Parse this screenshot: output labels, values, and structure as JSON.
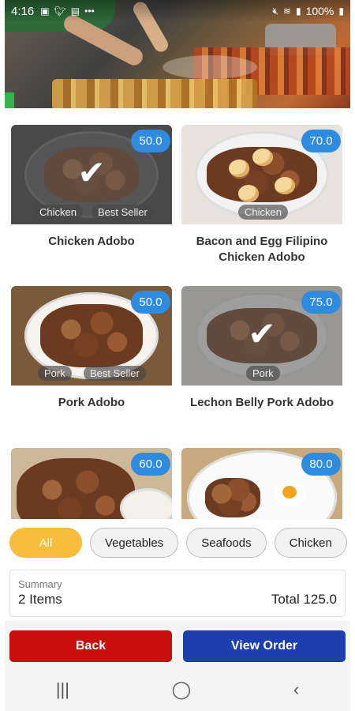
{
  "status_bar": {
    "time": "4:16",
    "battery": "100%",
    "icons_left": [
      "image-icon",
      "twitter-icon",
      "gallery-icon",
      "more-dots-icon"
    ],
    "icons_right": [
      "mute-icon",
      "wifi-icon",
      "signal-icon",
      "battery-icon"
    ]
  },
  "menu_items": [
    {
      "name": "Chicken Adobo",
      "price": "50.0",
      "tags": [
        "Chicken",
        "Best Seller"
      ],
      "selected": true
    },
    {
      "name": "Bacon and Egg Filipino Chicken Adobo",
      "price": "70.0",
      "tags": [
        "Chicken"
      ],
      "selected": false
    },
    {
      "name": "Pork Adobo",
      "price": "50.0",
      "tags": [
        "Pork",
        "Best Seller"
      ],
      "selected": false
    },
    {
      "name": "Lechon Belly Pork Adobo",
      "price": "75.0",
      "tags": [
        "Pork"
      ],
      "selected": true
    },
    {
      "name": "",
      "price": "60.0",
      "tags": [],
      "selected": false
    },
    {
      "name": "",
      "price": "80.0",
      "tags": [],
      "selected": false
    }
  ],
  "categories": [
    "All",
    "Vegetables",
    "Seafoods",
    "Chicken"
  ],
  "active_category": "All",
  "summary": {
    "label": "Summary",
    "items": "2 Items",
    "total": "Total 125.0"
  },
  "buttons": {
    "back": "Back",
    "view_order": "View Order"
  },
  "colors": {
    "price_badge": "#2f8be0",
    "chip_active": "#f6bc3a",
    "back_button": "#c80d0d",
    "view_order_button": "#1c3fae"
  }
}
